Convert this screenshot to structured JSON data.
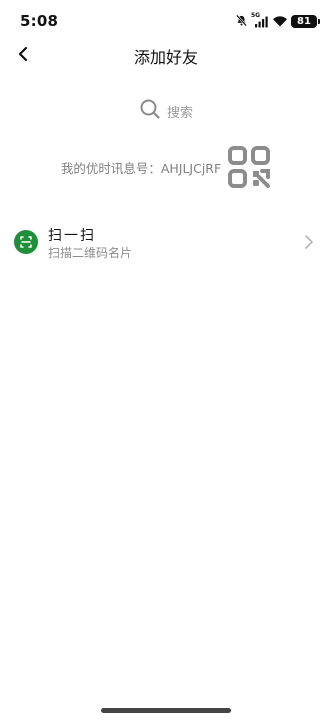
{
  "status_bar": {
    "time": "5:08",
    "network": "5G",
    "battery": "81"
  },
  "nav": {
    "title": "添加好友"
  },
  "search": {
    "placeholder": "搜索"
  },
  "my_id": {
    "label": "我的优时讯息号：AHJLJCjRF"
  },
  "scan": {
    "title": "扫一扫",
    "subtitle": "扫描二维码名片"
  },
  "colors": {
    "accent_green": "#1f8f3a",
    "muted_text": "#8d8d8d"
  }
}
